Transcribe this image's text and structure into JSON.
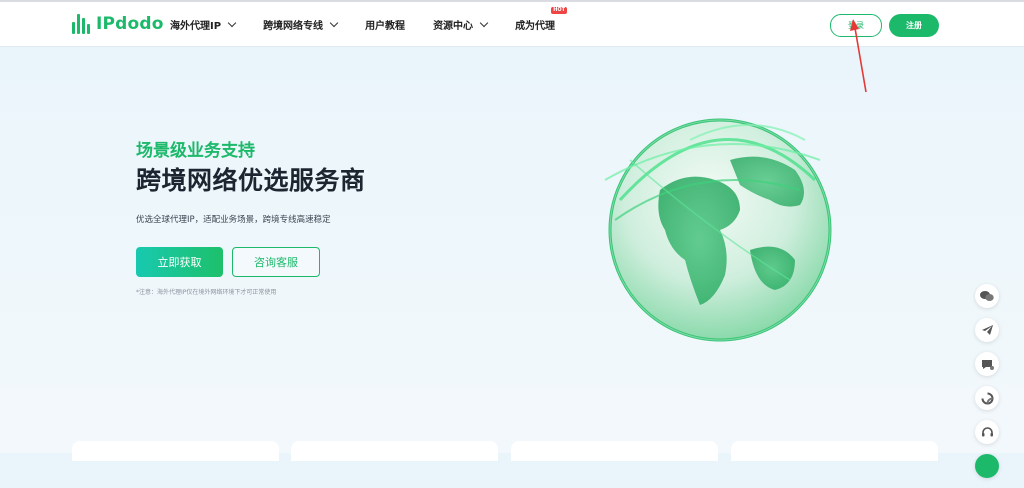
{
  "brand": {
    "logo_text": "IPdodo",
    "color": "#1db96b"
  },
  "nav": {
    "items": [
      {
        "label": "海外代理IP",
        "dropdown": true
      },
      {
        "label": "跨境网络专线",
        "dropdown": true
      },
      {
        "label": "用户教程",
        "dropdown": false
      },
      {
        "label": "资源中心",
        "dropdown": true
      },
      {
        "label": "成为代理",
        "dropdown": false,
        "badge": "HOT"
      }
    ],
    "login_label": "登录",
    "register_label": "注册"
  },
  "hero": {
    "subtitle": "场景级业务支持",
    "title": "跨境网络优选服务商",
    "description": "优选全球代理IP，适配业务场景，跨境专线高速稳定",
    "primary_button": "立即获取",
    "secondary_button": "咨询客服",
    "note": "*注意：海外代理IP仅在境外网络环境下才可正常使用"
  },
  "sidebar": {
    "icons": [
      "wechat-icon",
      "telegram-icon",
      "chat-icon",
      "refresh-icon",
      "headset-icon",
      "more-icon"
    ]
  },
  "colors": {
    "accent": "#1db96b",
    "hot": "#ef4444",
    "annotation_arrow": "#e53935"
  }
}
